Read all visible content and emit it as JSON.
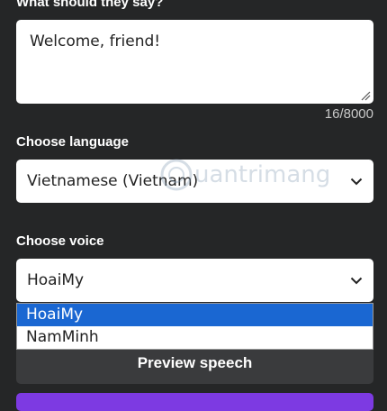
{
  "message_section": {
    "label": "What should they say?",
    "text": "Welcome, friend!",
    "counter": "16/8000"
  },
  "language_section": {
    "label": "Choose language",
    "selected": "Vietnamese (Vietnam)"
  },
  "voice_section": {
    "label": "Choose voice",
    "selected": "HoaiMy",
    "options": [
      "HoaiMy",
      "NamMinh"
    ]
  },
  "actions": {
    "preview_label": "Preview speech"
  },
  "watermark": {
    "text": "uantrimang"
  },
  "colors": {
    "background": "#252627",
    "highlight": "#1a67d2",
    "primary_button": "#7d3ae2"
  }
}
